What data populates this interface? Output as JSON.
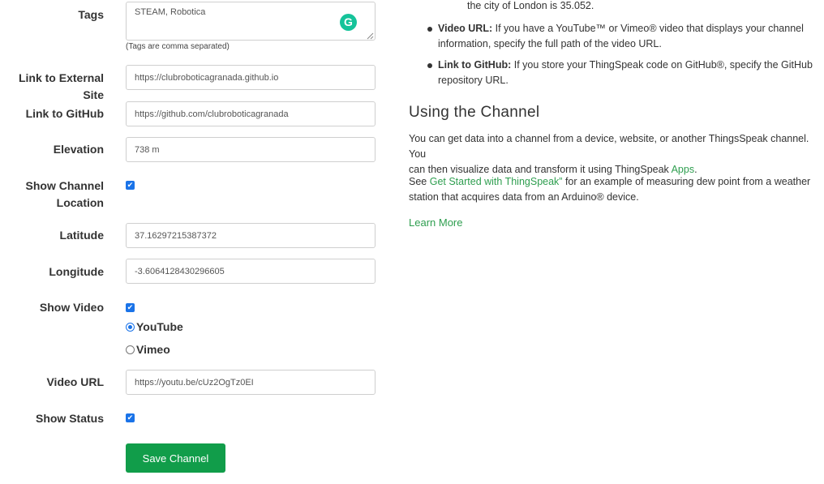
{
  "form": {
    "tags_label": "Tags",
    "tags_value": "STEAM, Robotica",
    "tags_hint": "(Tags are comma separated)",
    "external_site_label": "Link to External Site",
    "external_site_value": "https://clubroboticagranada.github.io",
    "github_label": "Link to GitHub",
    "github_value": "https://github.com/clubroboticagranada",
    "elevation_label": "Elevation",
    "elevation_value": "738 m",
    "show_location_label_1": "Show Channel",
    "show_location_label_2": "Location",
    "latitude_label": "Latitude",
    "latitude_value": "37.16297215387372",
    "longitude_label": "Longitude",
    "longitude_value": "-3.6064128430296605",
    "show_video_label": "Show Video",
    "youtube_label": "YouTube",
    "vimeo_label": "Vimeo",
    "video_url_label": "Video URL",
    "video_url_value": "https://youtu.be/cUz2OgTz0EI",
    "show_status_label": "Show Status",
    "save_label": "Save Channel",
    "checkbox_mark": "✔",
    "grammarly_glyph": "G"
  },
  "help": {
    "london_tail": "the city of London is 35.052.",
    "video_bold": "Video URL:",
    "video_text_1": " If you have a YouTube™ or Vimeo® video that displays your channel",
    "video_text_2": "information, specify the full path of the video URL.",
    "github_bold": "Link to GitHub:",
    "github_text_1": " If you store your ThingSpeak code on GitHub®, specify the GitHub",
    "github_text_2": "repository URL.",
    "section_title": "Using the Channel",
    "para1_line1": "You can get data into a channel from a device, website, or another ThingsSpeak channel. You",
    "para1_line2_a": "can then visualize data and transform it using ThingSpeak ",
    "para1_link": "Apps",
    "para1_line2_b": ".",
    "para2_see": "See ",
    "para2_link": "Get Started with ThingSpeak”",
    "para2_line1_b": " for an example of measuring dew point from a weather",
    "para2_line2": "station that acquires data from an Arduino® device.",
    "learn_more": "Learn More"
  },
  "colors": {
    "accent_green": "#119d4a",
    "link_green": "#2e9e4f",
    "checkbox_blue": "#1a73e8"
  }
}
